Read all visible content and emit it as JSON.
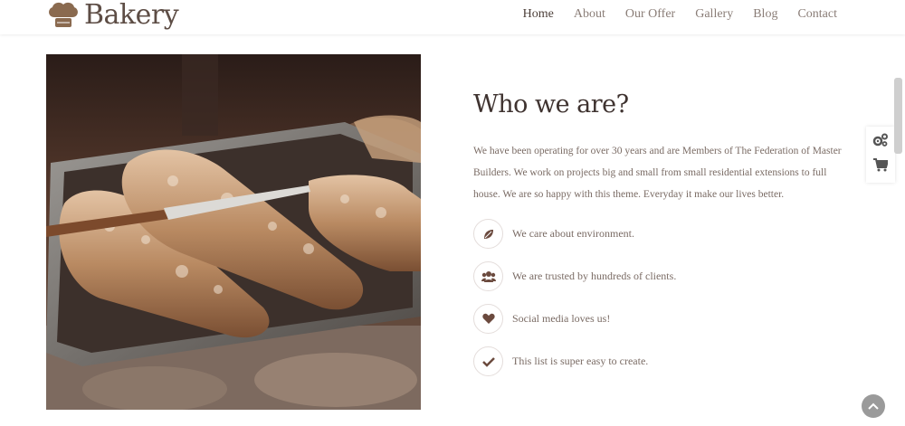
{
  "brand": {
    "name": "Bakery"
  },
  "nav": {
    "items": [
      {
        "label": "Home",
        "active": true
      },
      {
        "label": "About"
      },
      {
        "label": "Our Offer"
      },
      {
        "label": "Gallery"
      },
      {
        "label": "Blog"
      },
      {
        "label": "Contact"
      }
    ]
  },
  "about": {
    "title": "Who we are?",
    "description": "We have been operating for over 30 years and are Members of The Federation of Master Builders. We work on projects big and small from small residential extensions to full house. We are so happy with this theme. Everyday it make our lives better."
  },
  "features": [
    {
      "icon": "leaf-icon",
      "label": "We care about environment."
    },
    {
      "icon": "users-icon",
      "label": "We are trusted by hundreds of clients."
    },
    {
      "icon": "heart-icon",
      "label": "Social media loves us!"
    },
    {
      "icon": "check-icon",
      "label": "This list is super easy to create."
    }
  ],
  "colors": {
    "accent": "#6b4a3e",
    "text": "#7a6b64",
    "heading": "#3f3330"
  }
}
